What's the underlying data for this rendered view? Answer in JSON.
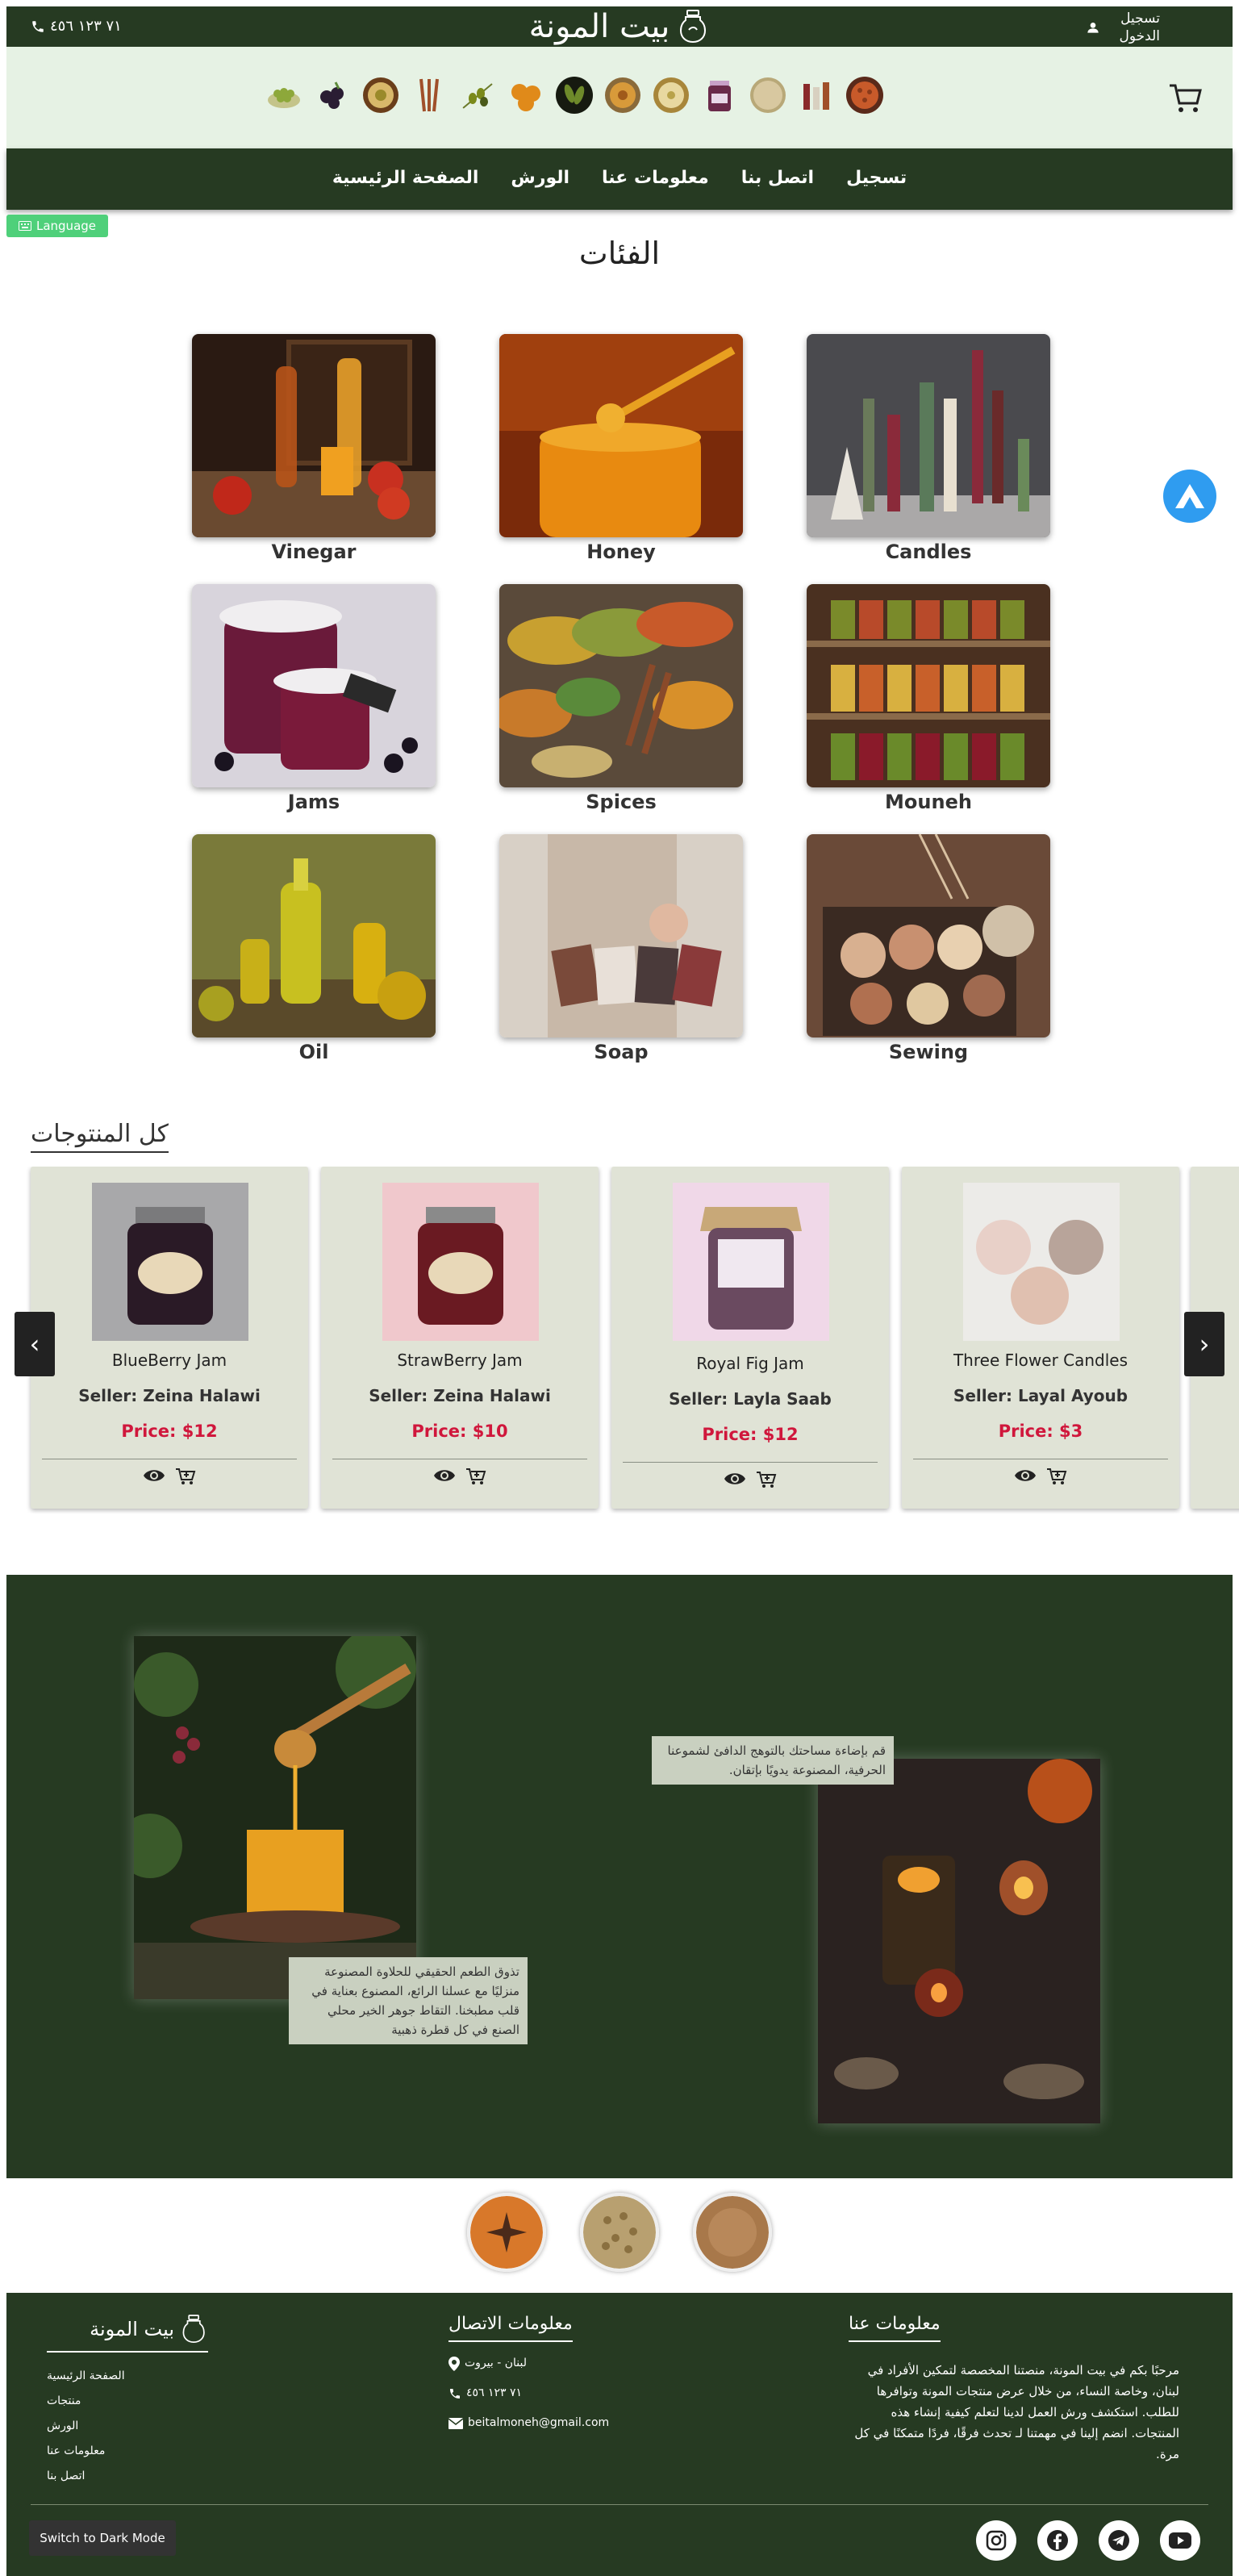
{
  "topbar": {
    "phone": "٧١ ١٢٣ ٤٥٦",
    "brand": "بيت المونة",
    "login_line1": "تسجيل",
    "login_line2": "الدخول"
  },
  "icon_strip": {
    "items": [
      "grapes-green-icon",
      "blackberries-icon",
      "hummus-bowl-icon",
      "cinnamon-sticks-icon",
      "olives-branch-icon",
      "dried-apricots-icon",
      "pickled-cucumbers-icon",
      "spice-bowl-icon",
      "dip-bowl-icon",
      "jam-jar-icon",
      "cheese-round-icon",
      "candles-icon",
      "spice-mix-icon"
    ]
  },
  "nav": {
    "items": [
      "تسجيل",
      "اتصل بنا",
      "معلومات عنا",
      "الورش",
      "الصفحة الرئيسية"
    ]
  },
  "language_button": "Language",
  "categories": {
    "title": "الفئات",
    "items": [
      {
        "label": "Vinegar"
      },
      {
        "label": "Honey"
      },
      {
        "label": "Candles"
      },
      {
        "label": "Jams"
      },
      {
        "label": "Spices"
      },
      {
        "label": "Mouneh"
      },
      {
        "label": "Oil"
      },
      {
        "label": "Soap"
      },
      {
        "label": "Sewing"
      }
    ]
  },
  "products": {
    "title": "كل المنتوجات",
    "items": [
      {
        "name": "BlueBerry Jam",
        "seller": "Seller: Zeina Halawi",
        "price": "Price: $12"
      },
      {
        "name": "StrawBerry Jam",
        "seller": "Seller: Zeina Halawi",
        "price": "Price: $10"
      },
      {
        "name": "Royal Fig Jam",
        "seller": "Seller: Layla Saab",
        "price": "Price: $12"
      },
      {
        "name": "Three Flower Candles",
        "seller": "Seller: Layal Ayoub",
        "price": "Price: $3"
      }
    ],
    "prev": "‹",
    "next": "›"
  },
  "promo": {
    "candle_caption": "قم بإضاءة مساحتك بالتوهج الدافئ لشموعنا الحرفية، المصنوعة يدويًا بإتقان.",
    "honey_caption": "تذوق الطعم الحقيقي للحلاوة المصنوعة منزليًا مع عسلنا الرائع، المصنوع بعناية في قلب مطبخنا. التقاط جوهر الخير محلي الصنع في كل قطرة ذهبية"
  },
  "footer": {
    "brand": "بيت المونة",
    "links": [
      "الصفحة الرئيسية",
      "منتجات",
      "الورش",
      "معلومات عنا",
      "اتصل بنا"
    ],
    "contact_title": "معلومات الاتصال",
    "address": "لبنان - بيروت",
    "phone": "٧١ ١٢٣ ٤٥٦",
    "email": "beitalmoneh@gmail.com",
    "about_title": "معلومات عنا",
    "about_text": "مرحبًا بكم في بيت المونة، منصتنا المخصصة لتمكين الأفراد في لبنان، وخاصة النساء، من خلال عرض منتجات المونة وتوافرها للطلب. استكشف ورش العمل لدينا لتعلم كيفية إنشاء هذه المنتجات. انضم إلينا في مهمتنا لـ تحدث فرقًا، فردًا متمكنًا في كل مرة.",
    "dark_mode": "Switch to Dark Mode",
    "socials": [
      "instagram-icon",
      "facebook-icon",
      "telegram-icon",
      "youtube-icon"
    ]
  },
  "colors": {
    "dark_green": "#263a22",
    "light_green": "#e6f2e4",
    "price_red": "#d0173c",
    "card_bg": "#e0e3d6",
    "language_green": "#4fd07a"
  }
}
